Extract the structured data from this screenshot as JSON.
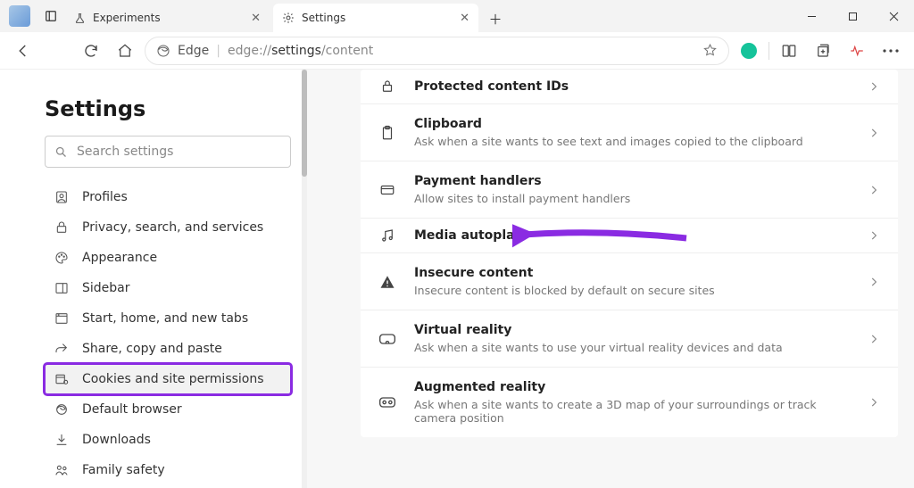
{
  "window": {
    "tabs": [
      {
        "label": "Experiments",
        "icon": "flask-icon",
        "active": false
      },
      {
        "label": "Settings",
        "icon": "gear-icon",
        "active": true
      }
    ]
  },
  "toolbar": {
    "edge_label": "Edge",
    "url_prefix": "edge://",
    "url_bold": "settings",
    "url_suffix": "/content"
  },
  "sidebar": {
    "title": "Settings",
    "search_placeholder": "Search settings",
    "items": [
      {
        "label": "Profiles",
        "icon": "profile-icon"
      },
      {
        "label": "Privacy, search, and services",
        "icon": "lock-icon"
      },
      {
        "label": "Appearance",
        "icon": "palette-icon"
      },
      {
        "label": "Sidebar",
        "icon": "sidebar-icon"
      },
      {
        "label": "Start, home, and new tabs",
        "icon": "home-tab-icon"
      },
      {
        "label": "Share, copy and paste",
        "icon": "share-icon"
      },
      {
        "label": "Cookies and site permissions",
        "icon": "cookie-icon",
        "selected": true,
        "highlighted": true
      },
      {
        "label": "Default browser",
        "icon": "edge-icon"
      },
      {
        "label": "Downloads",
        "icon": "download-icon"
      },
      {
        "label": "Family safety",
        "icon": "family-icon"
      }
    ]
  },
  "main": {
    "rows": [
      {
        "title": "Protected content IDs",
        "desc": "",
        "icon": "shield-lock-icon"
      },
      {
        "title": "Clipboard",
        "desc": "Ask when a site wants to see text and images copied to the clipboard",
        "icon": "clipboard-icon"
      },
      {
        "title": "Payment handlers",
        "desc": "Allow sites to install payment handlers",
        "icon": "card-icon"
      },
      {
        "title": "Media autoplay",
        "desc": "",
        "icon": "music-icon",
        "highlight_arrow": true
      },
      {
        "title": "Insecure content",
        "desc": "Insecure content is blocked by default on secure sites",
        "icon": "warning-icon"
      },
      {
        "title": "Virtual reality",
        "desc": "Ask when a site wants to use your virtual reality devices and data",
        "icon": "vr-icon"
      },
      {
        "title": "Augmented reality",
        "desc": "Ask when a site wants to create a 3D map of your surroundings or track camera position",
        "icon": "ar-icon"
      }
    ]
  },
  "annotation": {
    "arrow_color": "#8a2be2"
  }
}
